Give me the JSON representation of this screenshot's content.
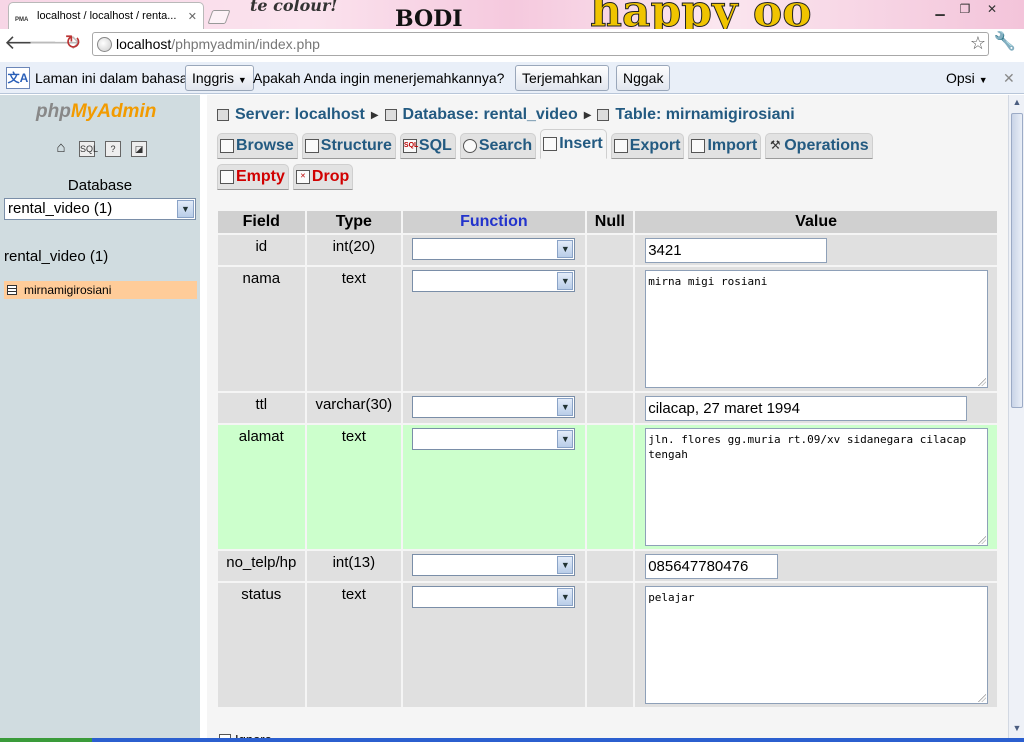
{
  "browser": {
    "tab_title": "localhost / localhost / renta...",
    "tab_favicon": "PMA",
    "url_host": "localhost",
    "url_path": "/phpmyadmin/index.php",
    "decor_text_1": "te colour!",
    "decor_text_2": "BODI",
    "decor_text_3": "happy oo"
  },
  "translate_bar": {
    "prefix": "Laman ini dalam bahasa",
    "language": "Inggris",
    "question": "Apakah Anda ingin menerjemahkannya?",
    "translate_button": "Terjemahkan",
    "dismiss_button": "Nggak",
    "options": "Opsi"
  },
  "left_panel": {
    "logo_php": "php",
    "logo_myadmin": "MyAdmin",
    "database_label": "Database",
    "database_selected": "rental_video (1)",
    "database_name": "rental_video (1)",
    "table_item": "mirnamigirosiani"
  },
  "breadcrumb": {
    "server": "Server: localhost",
    "database": "Database: rental_video",
    "table": "Table: mirnamigirosiani"
  },
  "tabs": [
    {
      "label": "Browse",
      "icon": "browse-icon",
      "active": false
    },
    {
      "label": "Structure",
      "icon": "structure-icon",
      "active": false
    },
    {
      "label": "SQL",
      "icon": "sql-icon",
      "active": false
    },
    {
      "label": "Search",
      "icon": "search-icon",
      "active": false
    },
    {
      "label": "Insert",
      "icon": "insert-icon",
      "active": true
    },
    {
      "label": "Export",
      "icon": "export-icon",
      "active": false
    },
    {
      "label": "Import",
      "icon": "import-icon",
      "active": false
    },
    {
      "label": "Operations",
      "icon": "operations-icon",
      "active": false
    }
  ],
  "tabs2": [
    {
      "label": "Empty",
      "icon": "empty-icon"
    },
    {
      "label": "Drop",
      "icon": "drop-icon"
    }
  ],
  "table": {
    "headers": {
      "field": "Field",
      "type": "Type",
      "function": "Function",
      "null": "Null",
      "value": "Value"
    },
    "rows": [
      {
        "field": "id",
        "type": "int(20)",
        "value": "3421"
      },
      {
        "field": "nama",
        "type": "text",
        "value": "mirna migi rosiani"
      },
      {
        "field": "ttl",
        "type": "varchar(30)",
        "value": "cilacap, 27 maret 1994"
      },
      {
        "field": "alamat",
        "type": "text",
        "value": "jln. flores gg.muria rt.09/xv sidanegara cilacap tengah"
      },
      {
        "field": "no_telp/hp",
        "type": "int(13)",
        "value": "085647780476"
      },
      {
        "field": "status",
        "type": "text",
        "value": "pelajar"
      }
    ]
  },
  "footer": {
    "ignore_label": "Ignore"
  },
  "colors": {
    "link": "#235a81",
    "highlight_row": "#ccffcc",
    "selected_table": "#ffcc99",
    "danger": "#d10000"
  }
}
